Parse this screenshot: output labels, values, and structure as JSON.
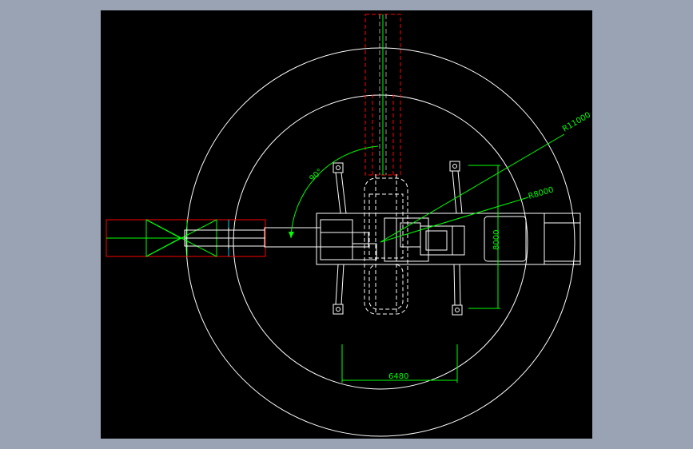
{
  "drawing": {
    "annotations": {
      "angle": "90°",
      "outer_radius": "R11000",
      "inner_radius": "R8000",
      "vertical_dim": "8000",
      "horizontal_dim": "6480"
    },
    "colors": {
      "background": "#000000",
      "frame": "#9aa3b4",
      "geometry": "#ffffff",
      "dimension": "#00ff00",
      "boom_outline": "#ff0000"
    }
  }
}
